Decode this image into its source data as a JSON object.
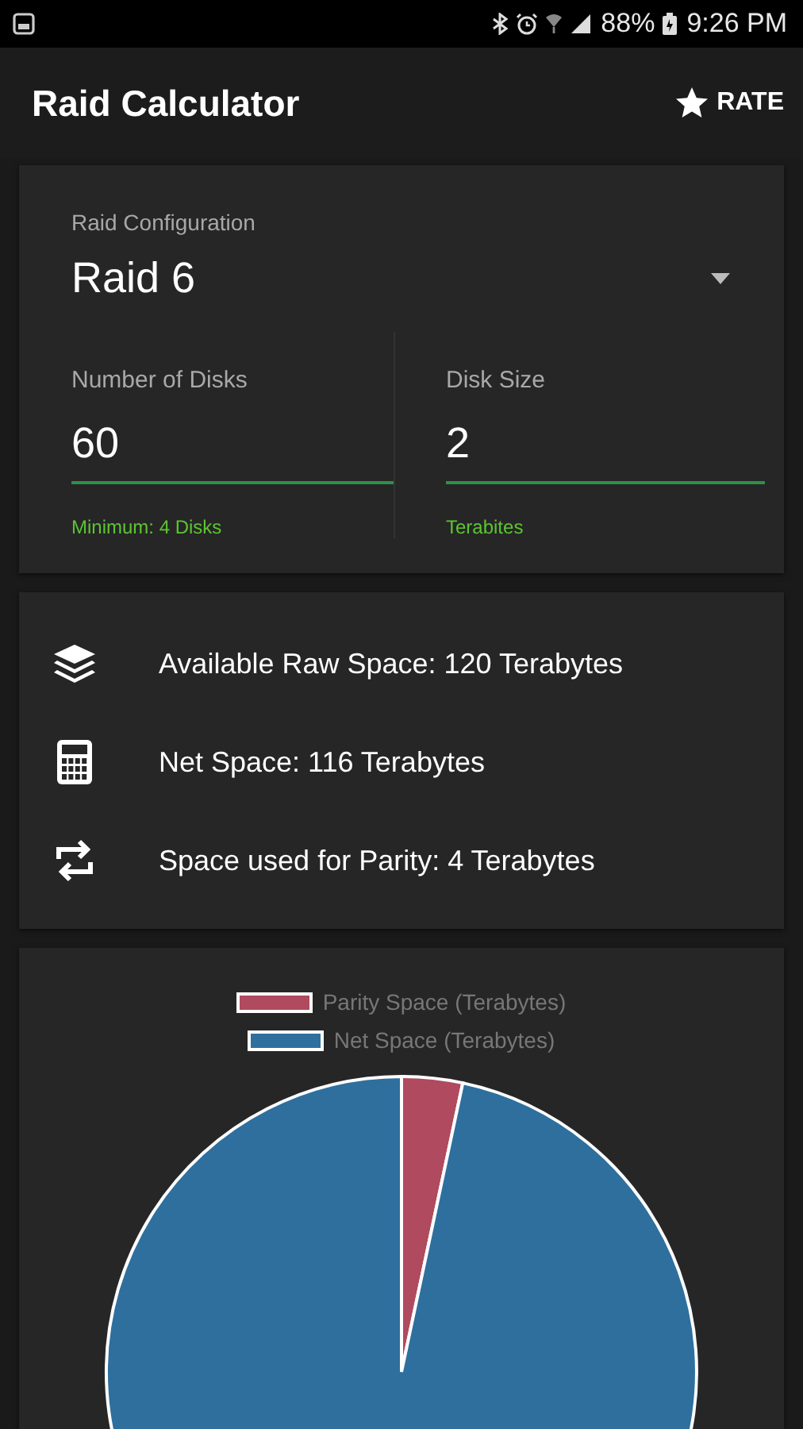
{
  "status_bar": {
    "battery": "88%",
    "time": "9:26 PM"
  },
  "app_bar": {
    "title": "Raid Calculator",
    "action": "RATE"
  },
  "config": {
    "label": "Raid Configuration",
    "value": "Raid 6",
    "fields": [
      {
        "label": "Number of Disks",
        "value": "60",
        "helper": "Minimum: 4 Disks"
      },
      {
        "label": "Disk Size",
        "value": "2",
        "helper": "Terabites"
      }
    ]
  },
  "results": [
    {
      "kind": "layers",
      "text": "Available Raw Space: 120 Terabytes"
    },
    {
      "kind": "calculator",
      "text": "Net Space: 116 Terabytes"
    },
    {
      "kind": "swap",
      "text": "Space used for Parity: 4 Terabytes"
    }
  ],
  "chart": {
    "slices": [
      {
        "color": "#b04a5e"
      },
      {
        "color": "#2e6f9e"
      }
    ],
    "chart_data": {
      "type": "pie",
      "legend": "top",
      "categories": [
        "Parity Space (Terabytes)",
        "Net Space (Terabytes)"
      ],
      "values": [
        3.33,
        96.67
      ]
    }
  }
}
